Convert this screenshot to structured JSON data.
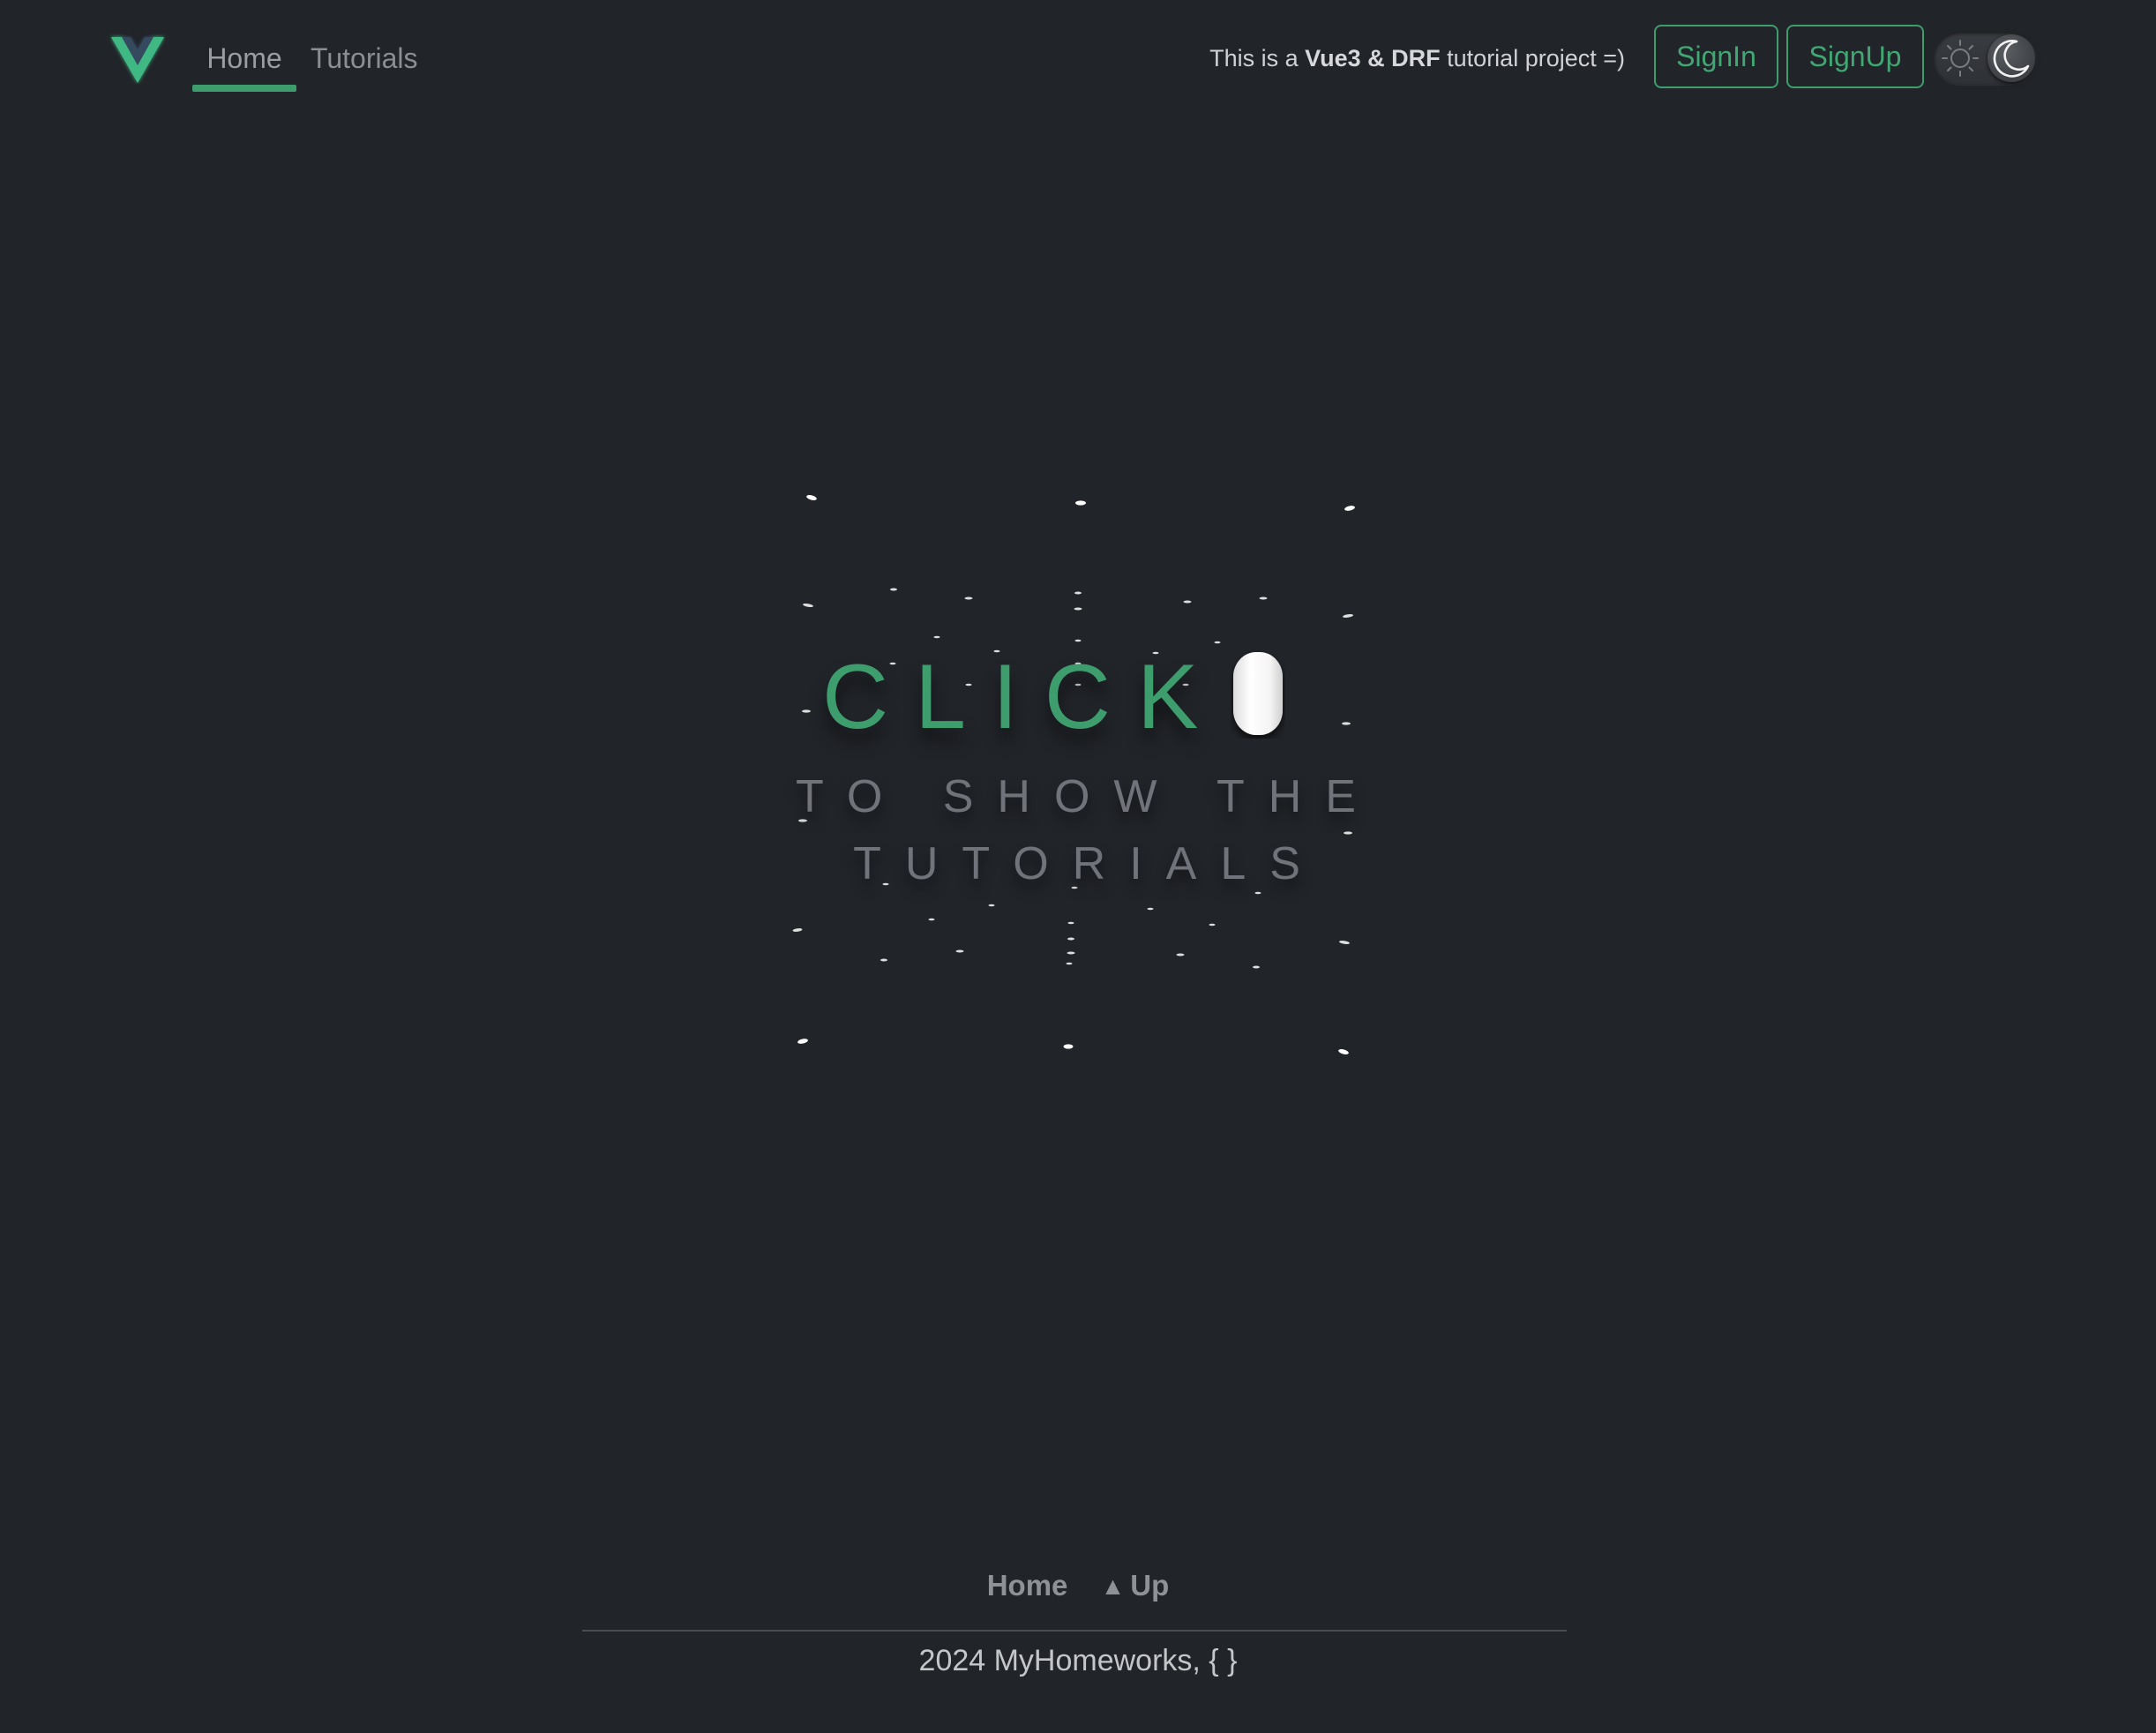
{
  "nav": {
    "logo": "vue-logo-icon",
    "links": [
      {
        "label": "Home",
        "active": true
      },
      {
        "label": "Tutorials",
        "active": false
      }
    ]
  },
  "header": {
    "tagline_prefix": "This is a ",
    "tagline_bold": "Vue3 & DRF",
    "tagline_suffix": " tutorial project =)",
    "signin_label": "SignIn",
    "signup_label": "SignUp",
    "theme": "dark"
  },
  "hero": {
    "click_text": "CLICK",
    "icon": "mouse-icon",
    "line1": "TO SHOW THE",
    "line2": "TUTORIALS"
  },
  "footer": {
    "home_label": "Home",
    "up_arrow": "▲",
    "up_label": "Up",
    "copyright": "2024 MyHomeworks, { }"
  },
  "colors": {
    "background": "#212429",
    "accent": "#3e9d6c",
    "muted_text": "#70737a"
  }
}
